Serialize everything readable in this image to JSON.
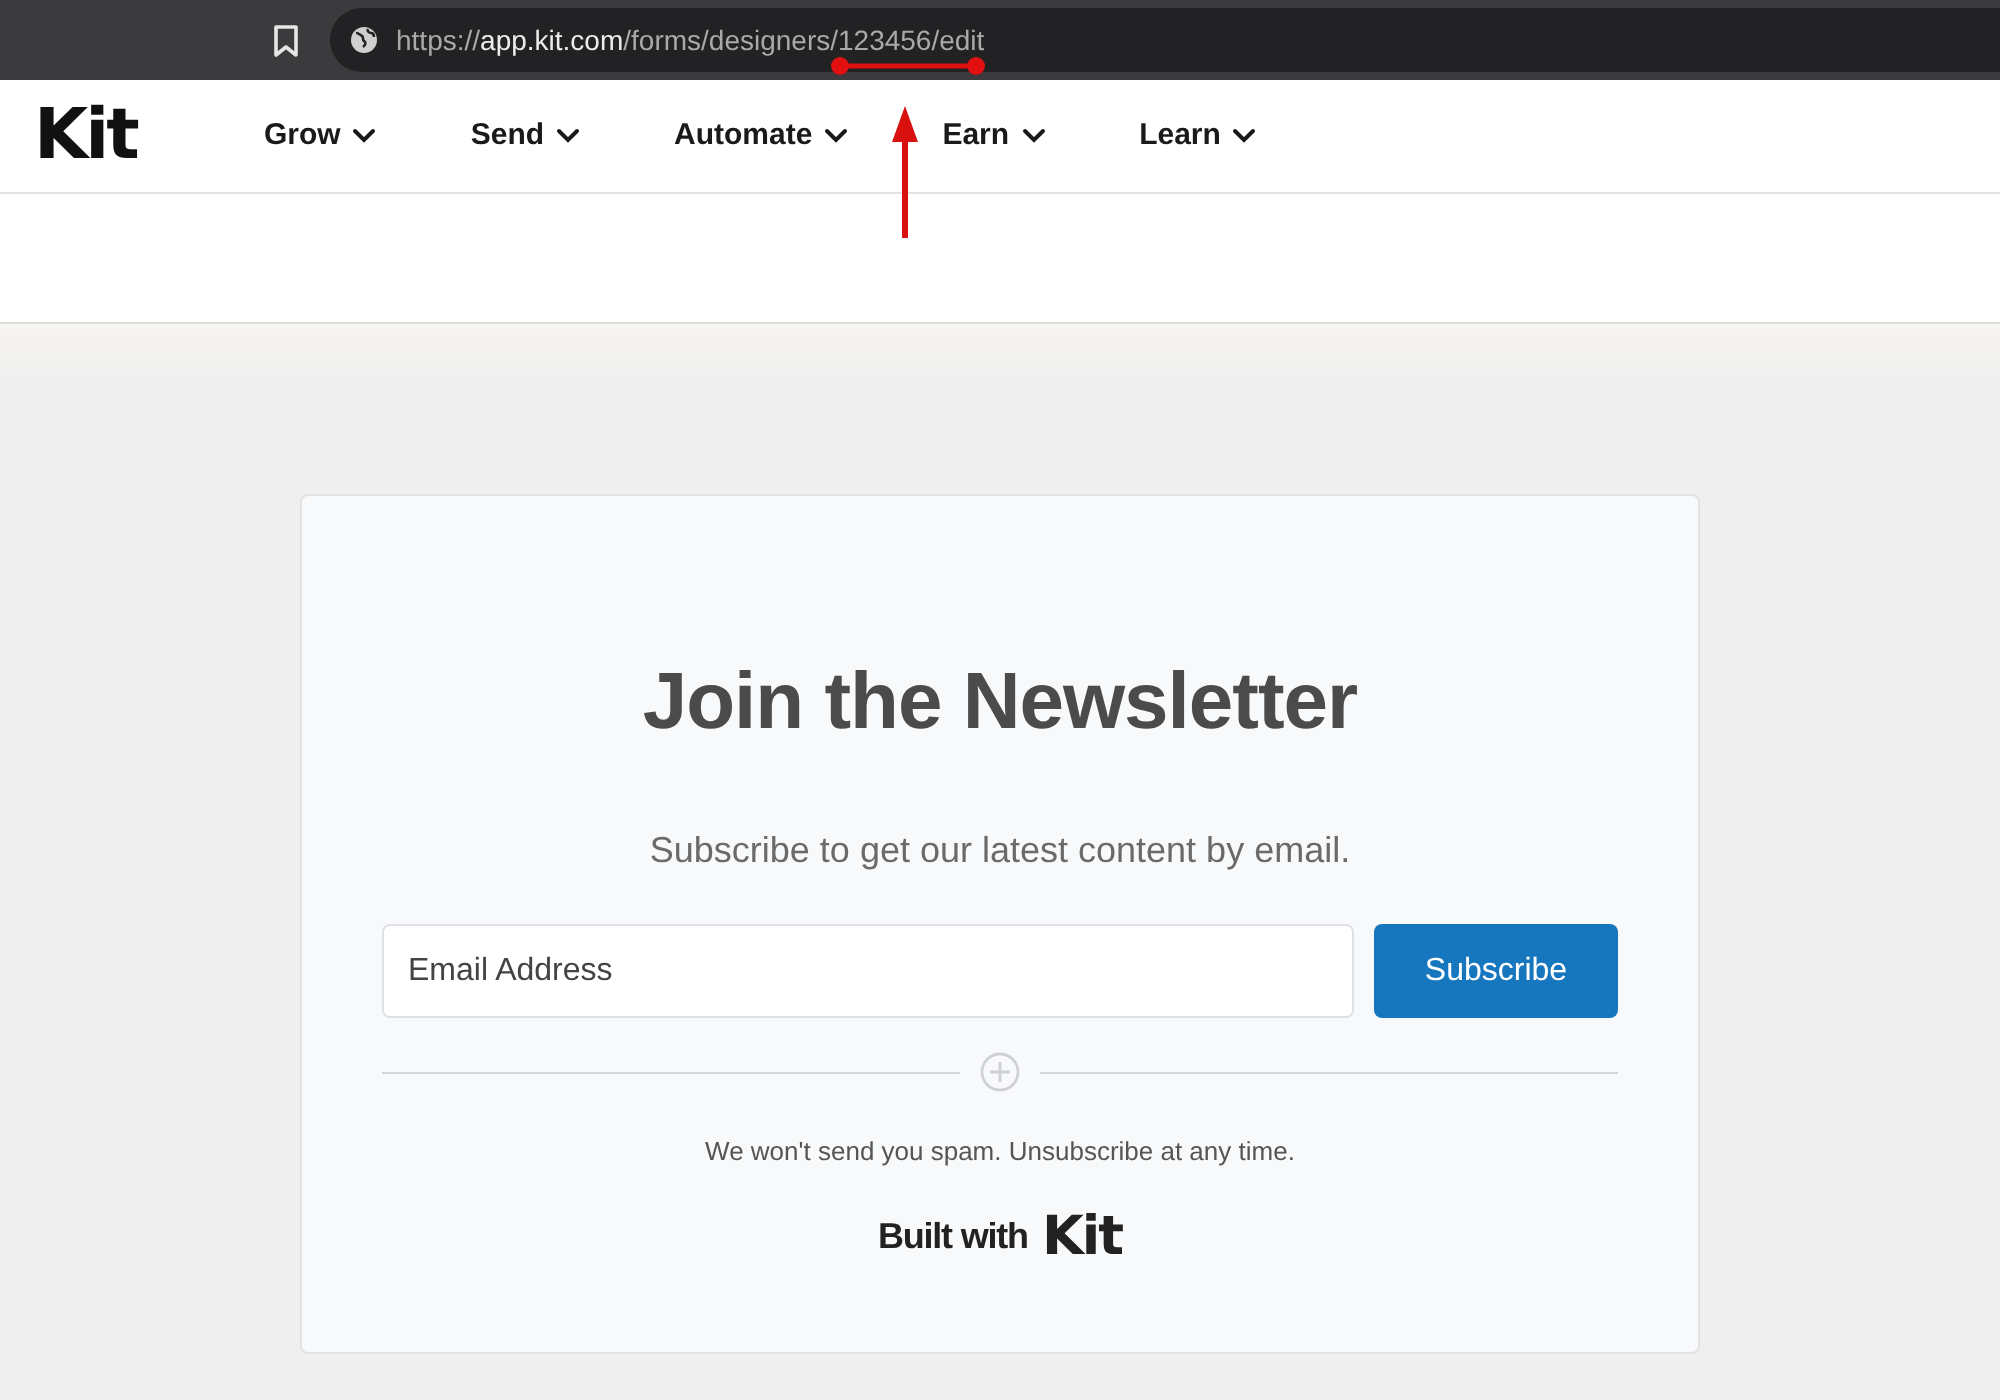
{
  "browser": {
    "url": {
      "scheme": "https://",
      "host": "app.kit.com",
      "path": "/forms/designers/123456/edit"
    }
  },
  "nav": {
    "logo": "Kit",
    "items": [
      "Grow",
      "Send",
      "Automate",
      "Earn",
      "Learn"
    ]
  },
  "form": {
    "title": "Join the Newsletter",
    "subtitle": "Subscribe to get our latest content by email.",
    "email": {
      "placeholder": "Email Address"
    },
    "button": "Subscribe",
    "disclaimer": "We won't send you spam. Unsubscribe at any time.",
    "built_with": {
      "label": "Built with",
      "logo": "Kit"
    }
  }
}
